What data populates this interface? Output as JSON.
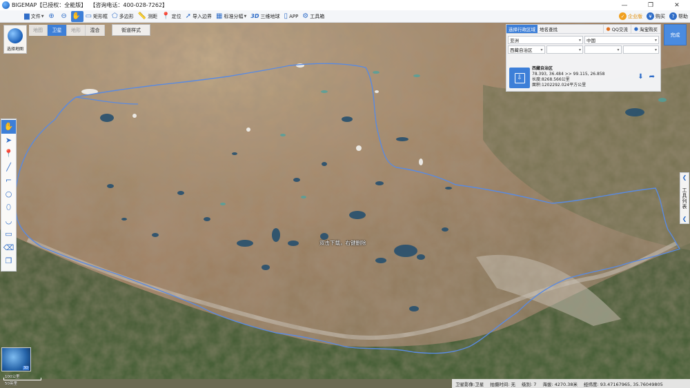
{
  "app": {
    "title": "BIGEMAP【已授权：全能版】  【咨询电话：400-028-7262】",
    "window_controls": [
      "—",
      "❐",
      "✕"
    ]
  },
  "toolbar": {
    "items": [
      {
        "icon": "folder-icon",
        "label": "文件",
        "dropdown": true
      },
      {
        "icon": "zoom-in-icon",
        "label": ""
      },
      {
        "icon": "zoom-out-icon",
        "label": ""
      },
      {
        "icon": "pan-hand-icon",
        "label": "",
        "active": true
      },
      {
        "icon": "rectangle-select-icon",
        "label": "矩形框"
      },
      {
        "icon": "polygon-select-icon",
        "label": "多边形"
      },
      {
        "icon": "measure-icon",
        "label": "测距"
      },
      {
        "icon": "locate-icon",
        "label": "定位"
      },
      {
        "icon": "import-boundary-icon",
        "label": "导入边界"
      },
      {
        "icon": "grid-icon",
        "label": "标准分幅",
        "dropdown": true
      },
      {
        "icon": "3d-icon",
        "label": "三维地球"
      },
      {
        "icon": "app-icon",
        "label": "APP"
      },
      {
        "icon": "gear-icon",
        "label": "工具箱"
      }
    ],
    "right": {
      "vip": "企业版",
      "buy": "购买",
      "help": "帮助"
    }
  },
  "map": {
    "tabs": [
      "地图",
      "卫星",
      "地形",
      "混合"
    ],
    "active_tab": "卫星",
    "street_style": "街道样式",
    "select_map": "选择地图",
    "hint": "双击下载，右键删除",
    "finish": "完成"
  },
  "region_panel": {
    "tabs": [
      "选择行政区域",
      "地名查找"
    ],
    "links": [
      "QQ交流",
      "淘宝购买"
    ],
    "row1": [
      "亚洲",
      "中国"
    ],
    "row2": [
      "西藏自治区",
      "",
      "",
      ""
    ],
    "region_name": "西藏自治区",
    "coords": "78.393, 36.484 >> 99.115, 26.858",
    "perimeter": "长度:8268.566公里",
    "area": "面积:1202292.024平方公里"
  },
  "tool_list": {
    "label": "工具列表"
  },
  "minimap": {
    "badge": "3D"
  },
  "scale": {
    "line1": "100公里",
    "line2": "50英里"
  },
  "status": {
    "layer": "卫星影像:卫星",
    "capture_time": "拍摄时间: 无",
    "level": "级别: 7",
    "altitude": "海拔: 4270.38米",
    "lnglat": "经纬度: 93.47167965, 35.76049805"
  }
}
